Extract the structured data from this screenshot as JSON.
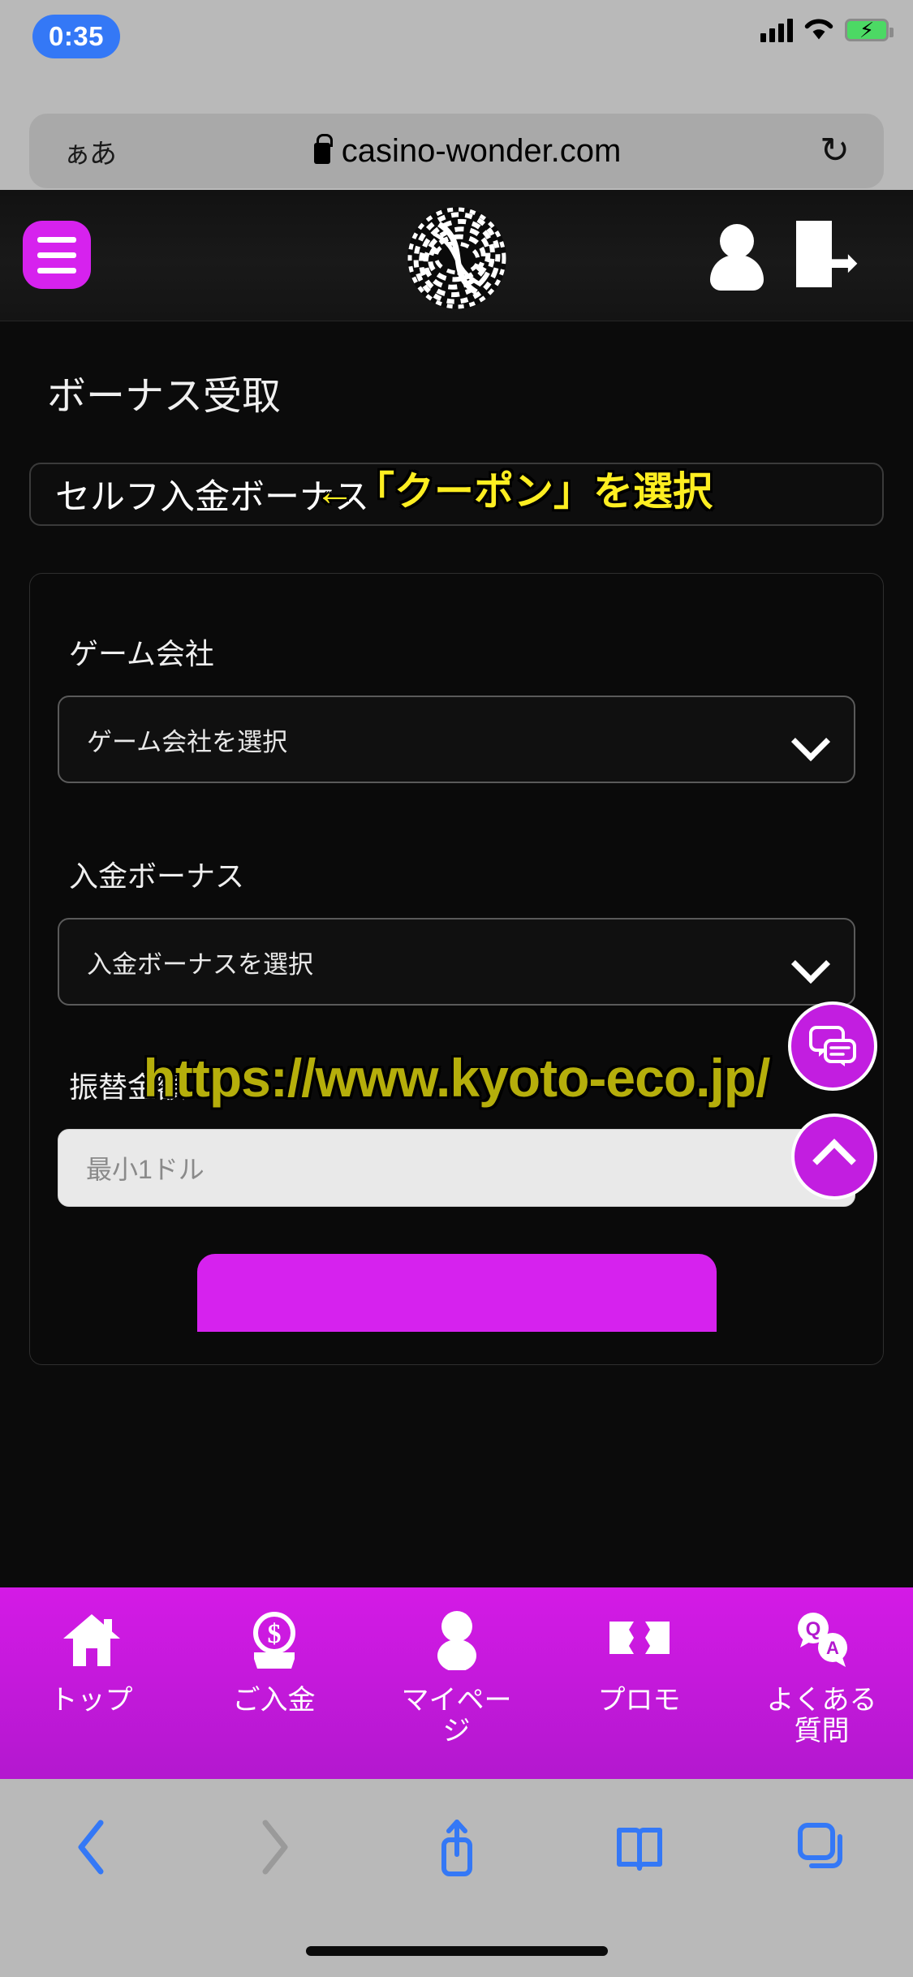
{
  "status_bar": {
    "recording_time": "0:35",
    "icons": [
      "signal-bars-icon",
      "wifi-icon",
      "battery-charging-icon"
    ]
  },
  "browser": {
    "text_size_button": "ぁあ",
    "lock_icon": "lock-icon",
    "url": "casino-wonder.com",
    "reload_icon": "↻",
    "toolbar": {
      "back": "‹",
      "forward": "›",
      "share": "share-icon",
      "bookmarks": "book-icon",
      "tabs": "tabs-icon"
    }
  },
  "site_header": {
    "menu_icon": "hamburger-icon",
    "logo": "spiral-vortex-logo",
    "account_icon": "user-avatar-icon",
    "logout_icon": "logout-icon"
  },
  "main": {
    "page_title": "ボーナス受取",
    "coupon_box": {
      "value": "セルフ入金ボーナス",
      "annotation": "←「クーポン」を選択",
      "annotation_color": "#fdee21"
    },
    "form": {
      "game_company": {
        "label": "ゲーム会社",
        "selected": "ゲーム会社を選択"
      },
      "deposit_bonus": {
        "label": "入金ボーナス",
        "selected": "入金ボーナスを選択"
      },
      "transfer_amount": {
        "label": "振替金額",
        "placeholder": "最小1ドル",
        "value": ""
      }
    }
  },
  "watermark": {
    "text": "https://www.kyoto-eco.jp/",
    "color": "#b5ae0b"
  },
  "floating_buttons": {
    "chat": "chat-bubbles-icon",
    "scroll_top": "chevron-up-icon",
    "color": "#c21ee0"
  },
  "bottom_nav": {
    "accent_color": "#d41ae6",
    "items": [
      {
        "label": "トップ",
        "icon": "home-icon"
      },
      {
        "label": "ご入金",
        "icon": "deposit-dollar-icon"
      },
      {
        "label": "マイページ",
        "icon": "user-icon"
      },
      {
        "label": "プロモ",
        "icon": "ticket-icon"
      },
      {
        "label": "よくある質問",
        "icon": "qa-bubbles-icon"
      }
    ]
  }
}
